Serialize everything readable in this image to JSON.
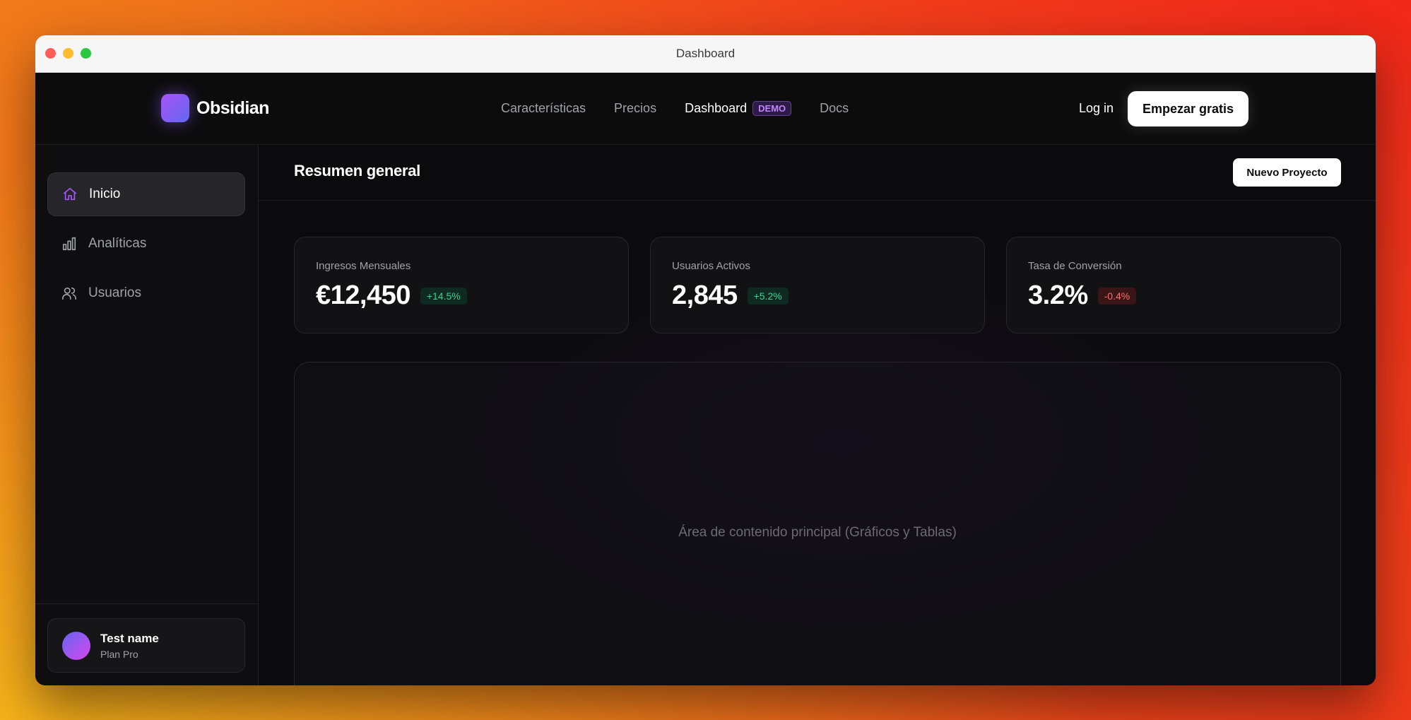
{
  "window": {
    "title": "Dashboard"
  },
  "nav": {
    "brand": "Obsidian",
    "links": [
      "Características",
      "Precios",
      "Dashboard",
      "Docs"
    ],
    "badge": "DEMO",
    "login": "Log in",
    "cta": "Empezar gratis"
  },
  "sidebar": {
    "items": [
      {
        "label": "Inicio",
        "icon": "home-icon"
      },
      {
        "label": "Analíticas",
        "icon": "bar-chart-icon"
      },
      {
        "label": "Usuarios",
        "icon": "users-icon"
      }
    ],
    "user": {
      "name": "Test name",
      "plan": "Plan Pro"
    }
  },
  "main": {
    "title": "Resumen general",
    "new_button": "Nuevo Proyecto",
    "stats": [
      {
        "label": "Ingresos Mensuales",
        "value": "€12,450",
        "delta": "+14.5%"
      },
      {
        "label": "Usuarios Activos",
        "value": "2,845",
        "delta": "+5.2%"
      },
      {
        "label": "Tasa de Conversión",
        "value": "3.2%",
        "delta": "-0.4%"
      }
    ],
    "placeholder": "Área de contenido principal (Gráficos y Tablas)"
  },
  "colors": {
    "accent": "#a855f7",
    "positive": "#34d399",
    "negative": "#f87171"
  }
}
